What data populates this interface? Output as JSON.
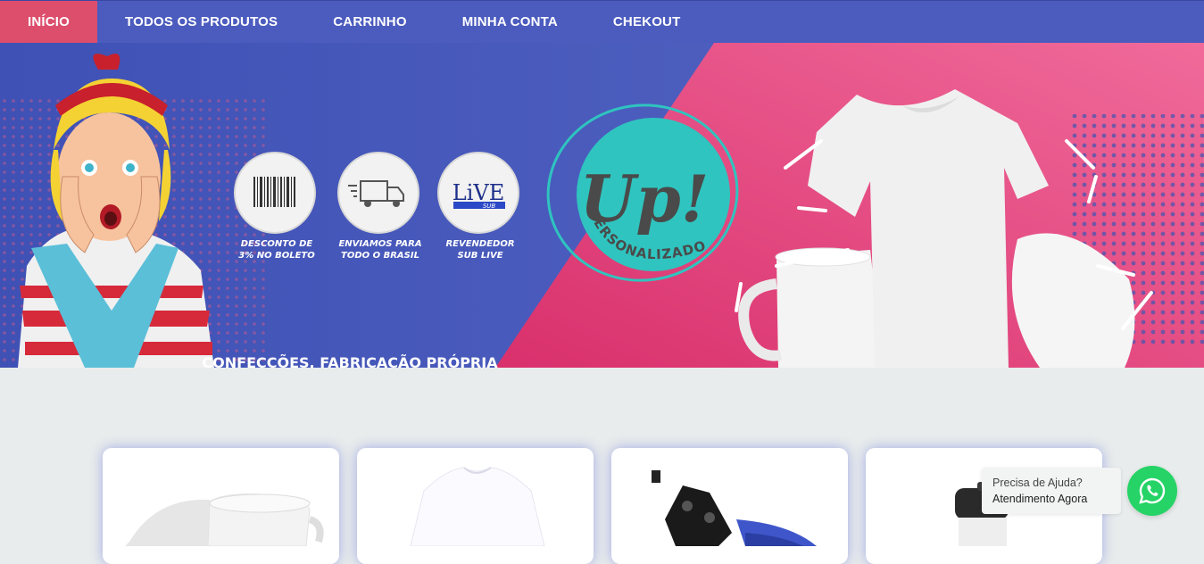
{
  "nav": {
    "items": [
      {
        "label": "INÍCIO",
        "active": true
      },
      {
        "label": "TODOS OS PRODUTOS",
        "active": false
      },
      {
        "label": "CARRINHO",
        "active": false
      },
      {
        "label": "MINHA CONTA",
        "active": false
      },
      {
        "label": "CHEKOUT",
        "active": false
      }
    ]
  },
  "hero": {
    "badges": [
      {
        "icon": "barcode-icon",
        "line1": "DESCONTO DE",
        "line2": "3% NO BOLETO"
      },
      {
        "icon": "truck-icon",
        "line1": "ENVIAMOS PARA",
        "line2": "TODO O BRASIL"
      },
      {
        "icon": "live-sub-logo",
        "logo_text": "LiVE",
        "logo_sub": "SUB",
        "line1": "REVENDEDOR",
        "line2": "SUB LIVE"
      }
    ],
    "logo": {
      "main": "Up!",
      "ring_text": "PERSONALIZADOS"
    },
    "tagline": "CONFECÇÕES, FABRICAÇÃO PRÓPRIA",
    "colors": {
      "blue": "#4f60bd",
      "pink": "#e2437a",
      "teal": "#2fc4bf"
    }
  },
  "products": [
    {
      "icon": "mug-product-image"
    },
    {
      "icon": "tshirt-product-image"
    },
    {
      "icon": "heat-press-product-image"
    },
    {
      "icon": "bottle-product-image"
    }
  ],
  "whatsapp": {
    "line1": "Precisa de Ajuda?",
    "line2": "Atendimento Agora",
    "icon": "whatsapp-icon",
    "color": "#25d366"
  }
}
